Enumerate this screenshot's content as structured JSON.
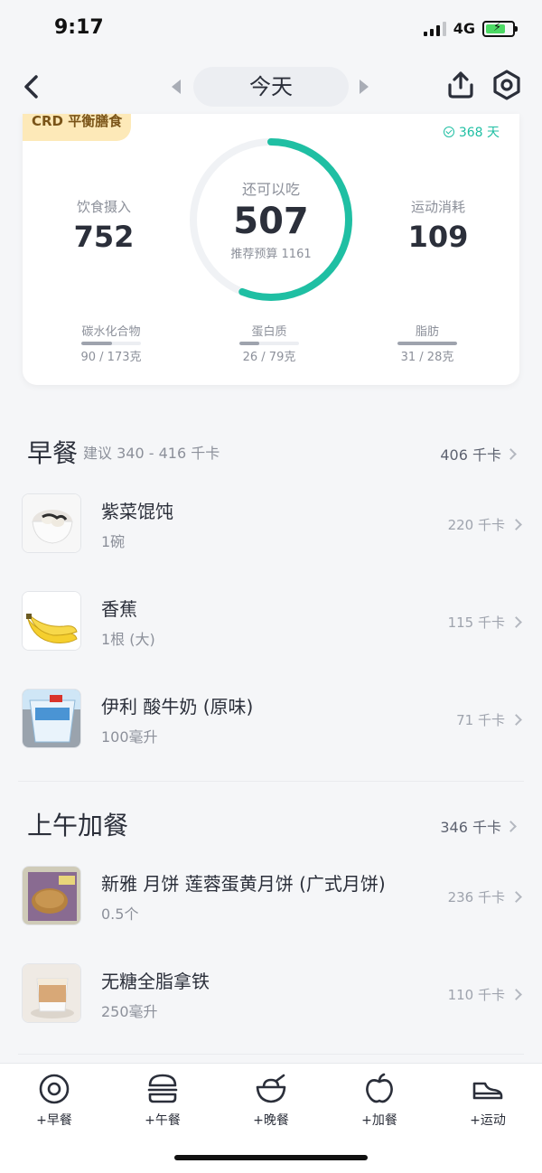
{
  "status": {
    "time": "9:17",
    "network": "4G"
  },
  "header": {
    "date_label": "今天"
  },
  "summary": {
    "plan_tag": "CRD 平衡膳食",
    "streak_days": "368 天",
    "intake_label": "饮食摄入",
    "intake_value": "752",
    "remaining_label": "还可以吃",
    "remaining_value": "507",
    "budget_text": "推荐预算 1161",
    "exercise_label": "运动消耗",
    "exercise_value": "109",
    "ring_progress": 0.56,
    "accent_color": "#1fbfa3",
    "macros": [
      {
        "name": "碳水化合物",
        "value": "90 / 173克",
        "fraction": 0.52
      },
      {
        "name": "蛋白质",
        "value": "26 / 79克",
        "fraction": 0.33
      },
      {
        "name": "脂肪",
        "value": "31 / 28克",
        "fraction": 1.0
      }
    ]
  },
  "meals": [
    {
      "title": "早餐",
      "hint": "建议 340 - 416 千卡",
      "total": "406 千卡",
      "items": [
        {
          "name": "紫菜馄饨",
          "qty": "1碗",
          "kcal": "220 千卡",
          "thumb": "wonton-bowl"
        },
        {
          "name": "香蕉",
          "qty": "1根 (大)",
          "kcal": "115 千卡",
          "thumb": "banana"
        },
        {
          "name": "伊利 酸牛奶 (原味)",
          "qty": "100毫升",
          "kcal": "71 千卡",
          "thumb": "yogurt-cup"
        }
      ]
    },
    {
      "title": "上午加餐",
      "hint": "",
      "total": "346 千卡",
      "items": [
        {
          "name": "新雅 月饼 莲蓉蛋黄月饼 (广式月饼)",
          "qty": "0.5个",
          "kcal": "236 千卡",
          "thumb": "mooncake"
        },
        {
          "name": "无糖全脂拿铁",
          "qty": "250毫升",
          "kcal": "110 千卡",
          "thumb": "latte"
        }
      ]
    }
  ],
  "tabs": [
    {
      "label": "+早餐",
      "icon": "breakfast-icon"
    },
    {
      "label": "+午餐",
      "icon": "burger-icon"
    },
    {
      "label": "+晚餐",
      "icon": "bowl-icon"
    },
    {
      "label": "+加餐",
      "icon": "apple-icon"
    },
    {
      "label": "+运动",
      "icon": "shoe-icon"
    }
  ]
}
